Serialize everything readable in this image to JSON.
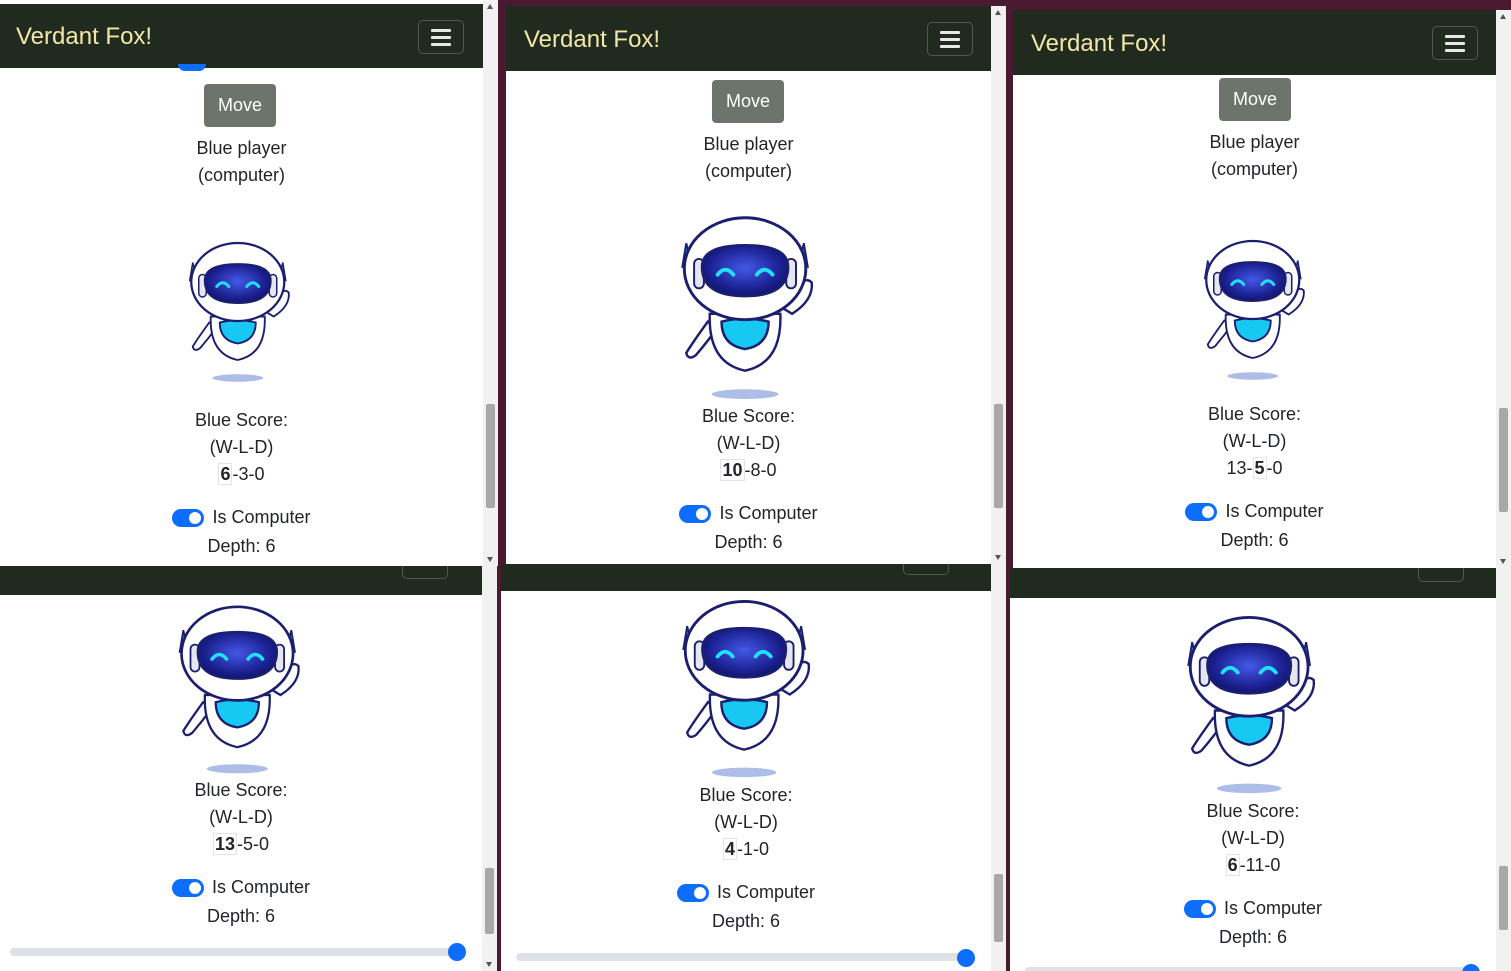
{
  "app": {
    "title": "Verdant Fox!"
  },
  "labels": {
    "move": "Move",
    "blue_player": "Blue player",
    "computer": "(computer)",
    "blue_score": "Blue Score:",
    "wld": "(W-L-D)",
    "is_computer": "Is Computer",
    "depth": "Depth: 6"
  },
  "windows": [
    {
      "score": {
        "w": "6",
        "l": "3",
        "d": "0",
        "bold": "w"
      }
    },
    {
      "score": {
        "w": "10",
        "l": "8",
        "d": "0",
        "bold": "w"
      }
    },
    {
      "score": {
        "w": "13",
        "l": "5",
        "d": "0",
        "bold": "l"
      }
    },
    {
      "score": {
        "w": "13",
        "l": "5",
        "d": "0",
        "bold": "w"
      }
    },
    {
      "score": {
        "w": "4",
        "l": "1",
        "d": "0",
        "bold": "w"
      }
    },
    {
      "score": {
        "w": "6",
        "l": "11",
        "d": "0",
        "bold": "w"
      }
    }
  ],
  "colors": {
    "navbar": "#212a1f",
    "brand": "#f2e7a8",
    "toggle_on": "#0d6efd",
    "move_button": "#6c746c"
  },
  "icons": {
    "menu": "hamburger-icon",
    "robot": "robot-avatar-icon"
  }
}
